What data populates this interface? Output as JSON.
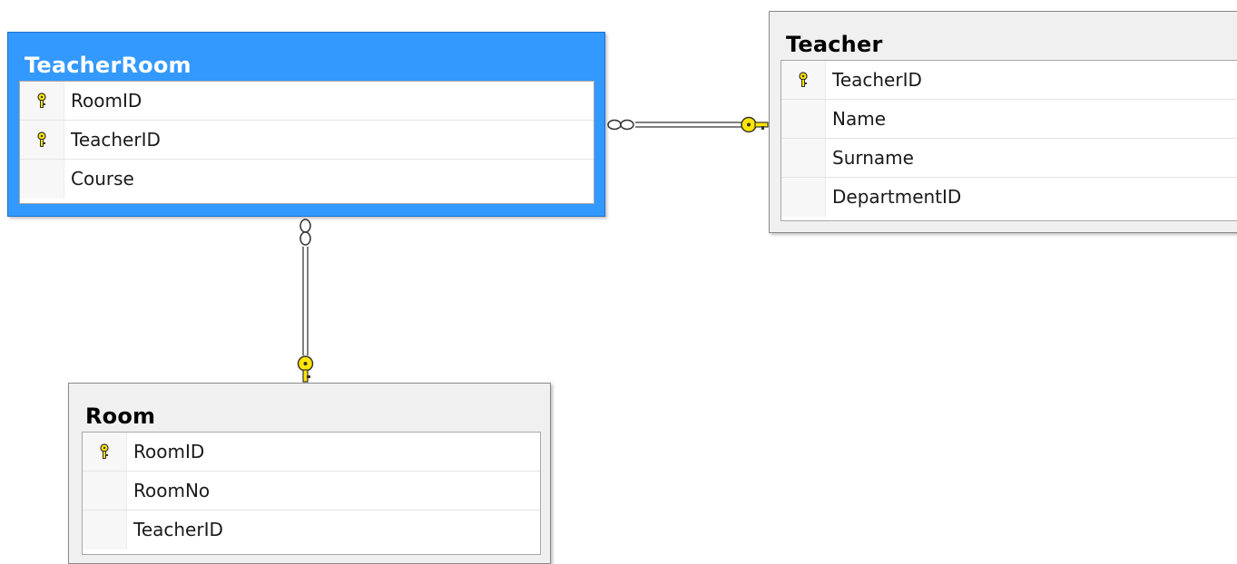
{
  "tables": {
    "teacher_room": {
      "title": "TeacherRoom",
      "selected": true,
      "columns": [
        {
          "name": "RoomID",
          "primary_key": true,
          "icon": "key-icon"
        },
        {
          "name": "TeacherID",
          "primary_key": true,
          "icon": "key-icon"
        },
        {
          "name": "Course",
          "primary_key": false
        }
      ]
    },
    "teacher": {
      "title": "Teacher",
      "selected": false,
      "columns": [
        {
          "name": "TeacherID",
          "primary_key": true,
          "icon": "key-icon"
        },
        {
          "name": "Name",
          "primary_key": false
        },
        {
          "name": "Surname",
          "primary_key": false
        },
        {
          "name": "DepartmentID",
          "primary_key": false
        }
      ]
    },
    "room": {
      "title": "Room",
      "selected": false,
      "columns": [
        {
          "name": "RoomID",
          "primary_key": true,
          "icon": "key-icon"
        },
        {
          "name": "RoomNo",
          "primary_key": false
        },
        {
          "name": "TeacherID",
          "primary_key": false
        }
      ]
    }
  },
  "relationships": [
    {
      "from": "TeacherRoom",
      "to": "Teacher",
      "from_end": "infinity-icon",
      "to_end": "key-icon"
    },
    {
      "from": "TeacherRoom",
      "to": "Room",
      "from_end": "infinity-icon",
      "to_end": "key-icon"
    }
  ],
  "colors": {
    "selected_table": "#3399ff",
    "key_fill": "#ffe500",
    "table_background": "#f0f0f0"
  }
}
